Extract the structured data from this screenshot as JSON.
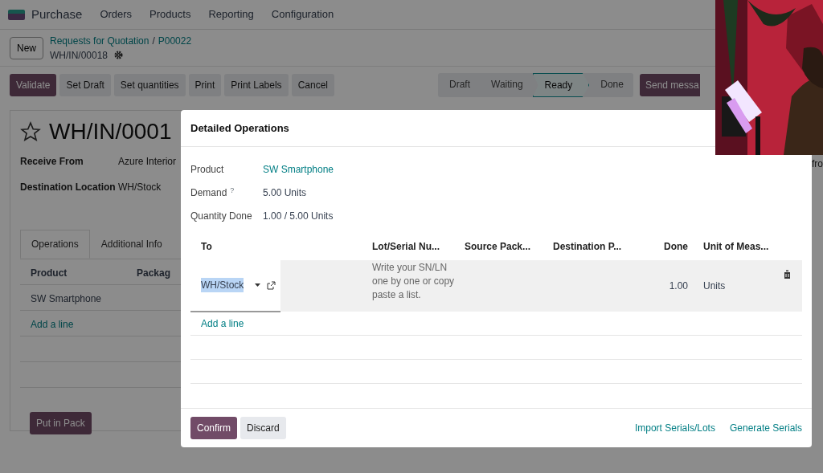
{
  "navbar": {
    "app": "Purchase",
    "menu": [
      "Orders",
      "Products",
      "Reporting",
      "Configuration"
    ]
  },
  "control_panel": {
    "new_button": "New",
    "breadcrumbs": [
      "Requests for Quotation",
      "P00022"
    ],
    "separator": "/",
    "record": "WH/IN/00018"
  },
  "actions": [
    {
      "label": "Validate",
      "kind": "primary"
    },
    {
      "label": "Set Draft",
      "kind": "secondary"
    },
    {
      "label": "Set quantities",
      "kind": "secondary"
    },
    {
      "label": "Print",
      "kind": "secondary"
    },
    {
      "label": "Print Labels",
      "kind": "secondary"
    },
    {
      "label": "Cancel",
      "kind": "secondary"
    }
  ],
  "stages": [
    {
      "label": "Draft",
      "selected": false
    },
    {
      "label": "Waiting",
      "selected": false
    },
    {
      "label": "Ready",
      "selected": true
    },
    {
      "label": "Done",
      "selected": false
    }
  ],
  "send_message": "Send messa",
  "side_text": "fro",
  "form": {
    "title": "WH/IN/0001",
    "starred": false,
    "fields": [
      {
        "label": "Receive From",
        "value": "Azure Interior"
      },
      {
        "label": "Destination Location",
        "value": "WH/Stock"
      }
    ],
    "tabs": [
      {
        "label": "Operations",
        "selected": true
      },
      {
        "label": "Additional Info",
        "selected": false
      }
    ],
    "columns": [
      "Product",
      "Packag"
    ],
    "rows": [
      "SW Smartphone"
    ],
    "add_line": "Add a line",
    "pack_button": "Put in Pack"
  },
  "dialog": {
    "title": "Detailed Operations",
    "fields": [
      {
        "label": "Product",
        "value": "SW Smartphone",
        "kind": "link"
      },
      {
        "label": "Demand",
        "hint": "?",
        "value": "5.00 Units",
        "kind": "text"
      },
      {
        "label": "Quantity Done",
        "value": "1.00 / 5.00 Units",
        "kind": "text"
      }
    ],
    "columns": [
      "To",
      "Lot/Serial Nu...",
      "Source Pack...",
      "Destination P...",
      "Done",
      "Unit of Meas..."
    ],
    "rows": [
      {
        "to": "WH/Stock",
        "highlighted": true,
        "lot_placeholder": "Write your SN/LN one by one or copy paste a list.",
        "done": "1.00",
        "unit": "Units"
      }
    ],
    "add_line": "Add a line",
    "confirm": "Confirm",
    "discard": "Discard",
    "links": [
      "Import Serials/Lots",
      "Generate Serials"
    ]
  }
}
